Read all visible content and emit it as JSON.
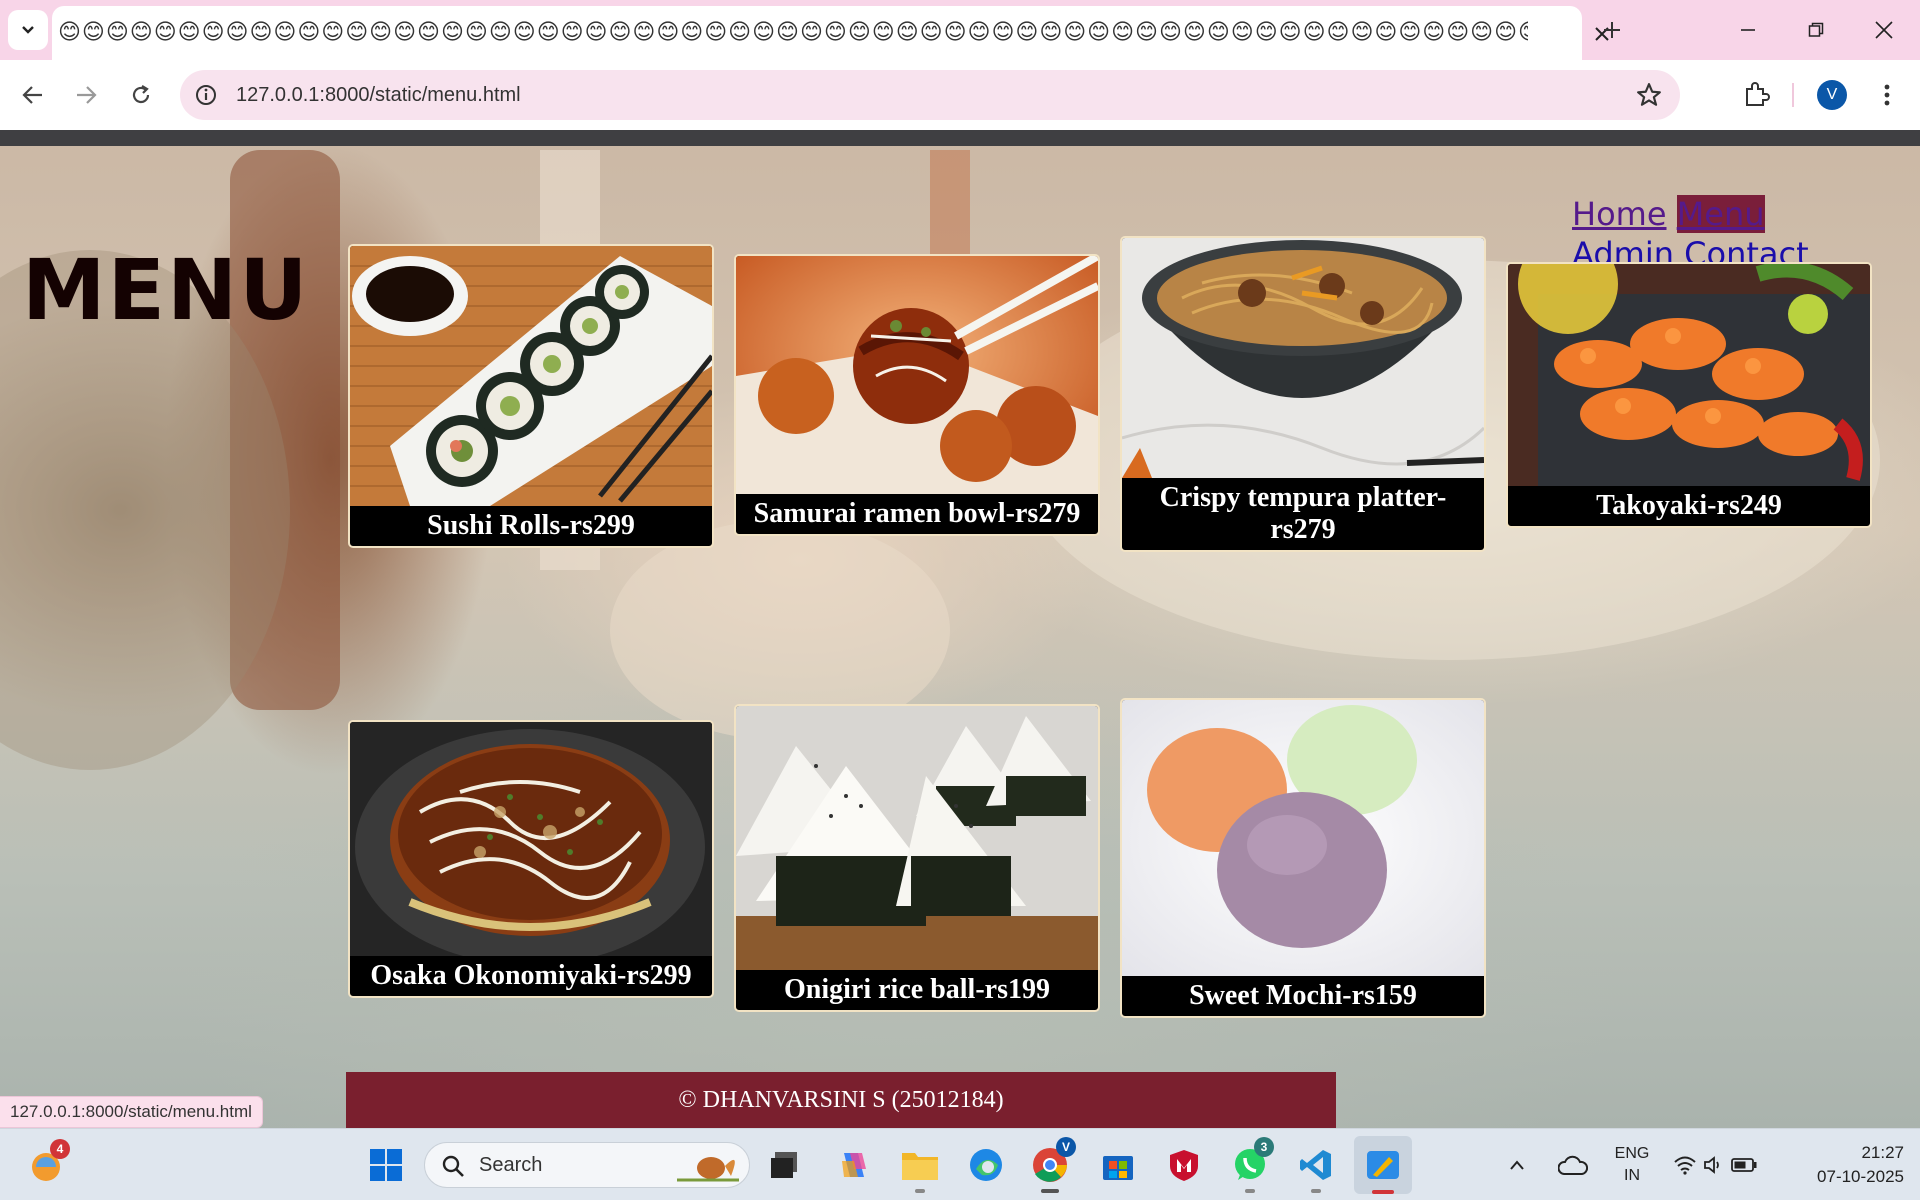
{
  "browser": {
    "tab_title": "😊😊😊😊😊😊😊😊😊😊😊😊😊😊😊😊😊😊😊😊😊😊😊😊😊😊😊😊😊😊😊😊😊😊😊😊😊😊😊😊😊😊😊😊😊😊😊😊😊😊😊😊😊😊😊😊😊😊😊😊😊😊😊😊😊😊😊😊😊😊😊😊😊😊😊😊😊😊😊😊😊😊",
    "url": "127.0.0.1:8000/static/menu.html",
    "profile_initial": "V",
    "status_url": "127.0.0.1:8000/static/menu.html"
  },
  "page": {
    "heading": "MENU",
    "nav": {
      "home": "Home",
      "menu": "Menu",
      "admin": "Admin",
      "contact": "Contact"
    },
    "items": [
      {
        "caption": "Sushi Rolls-rs299",
        "icon": "sushi-photo"
      },
      {
        "caption": "Samurai ramen bowl-rs279",
        "icon": "takoyaki-photo"
      },
      {
        "caption": "Crispy tempura platter-rs279",
        "icon": "noodle-bowl-photo"
      },
      {
        "caption": "Takoyaki-rs249",
        "icon": "fried-shrimp-photo"
      },
      {
        "caption": "Osaka Okonomiyaki-rs299",
        "icon": "okonomiyaki-photo"
      },
      {
        "caption": "Onigiri rice ball-rs199",
        "icon": "onigiri-photo"
      },
      {
        "caption": "Sweet Mochi-rs159",
        "icon": "mochi-photo"
      }
    ],
    "footer": "© DHANVARSINI S (25012184)"
  },
  "taskbar": {
    "search_placeholder": "Search",
    "weather_badge": "4",
    "chrome_badge": "V",
    "whatsapp_badge": "3",
    "lang_line1": "ENG",
    "lang_line2": "IN",
    "time": "21:27",
    "date": "07-10-2025"
  }
}
